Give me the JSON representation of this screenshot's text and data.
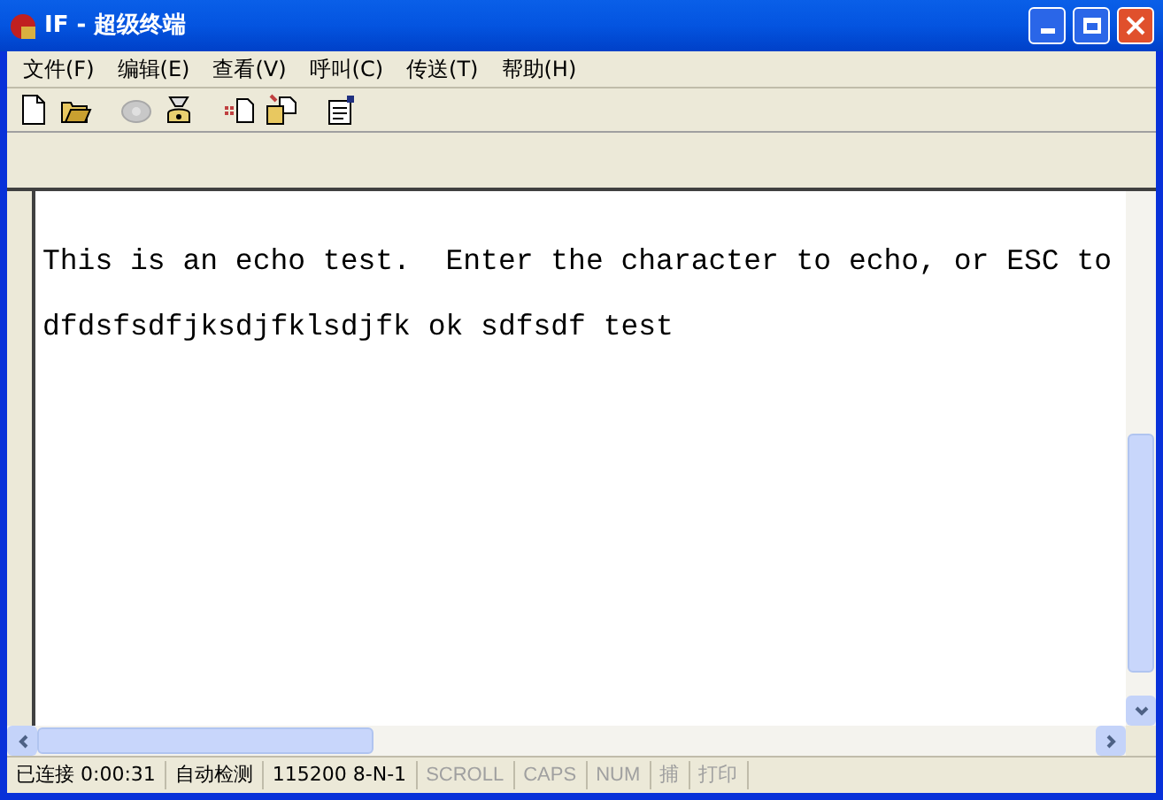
{
  "window": {
    "title": "IF - 超级终端"
  },
  "menu": [
    {
      "label": "文件(F)"
    },
    {
      "label": "编辑(E)"
    },
    {
      "label": "查看(V)"
    },
    {
      "label": "呼叫(C)"
    },
    {
      "label": "传送(T)"
    },
    {
      "label": "帮助(H)"
    }
  ],
  "toolbar": [
    {
      "kind": "new",
      "disabled": false
    },
    {
      "kind": "open",
      "disabled": false
    },
    {
      "kind": "call",
      "disabled": true
    },
    {
      "kind": "hangup",
      "disabled": false
    },
    {
      "kind": "send",
      "disabled": false
    },
    {
      "kind": "receive",
      "disabled": false
    },
    {
      "kind": "properties",
      "disabled": false
    }
  ],
  "terminal": {
    "lines": [
      "This is an echo test.  Enter the character to echo, or ESC to",
      "dfdsfsdfjksdjfklsdjfk ok sdfsdf test"
    ]
  },
  "status_bar": [
    {
      "text": "已连接 0:00:31",
      "active": true
    },
    {
      "text": "自动检测",
      "active": true
    },
    {
      "text": "115200 8-N-1",
      "active": true
    },
    {
      "text": "SCROLL",
      "active": false
    },
    {
      "text": "CAPS",
      "active": false
    },
    {
      "text": "NUM",
      "active": false
    },
    {
      "text": "捕",
      "active": false
    },
    {
      "text": "打印",
      "active": false
    }
  ]
}
